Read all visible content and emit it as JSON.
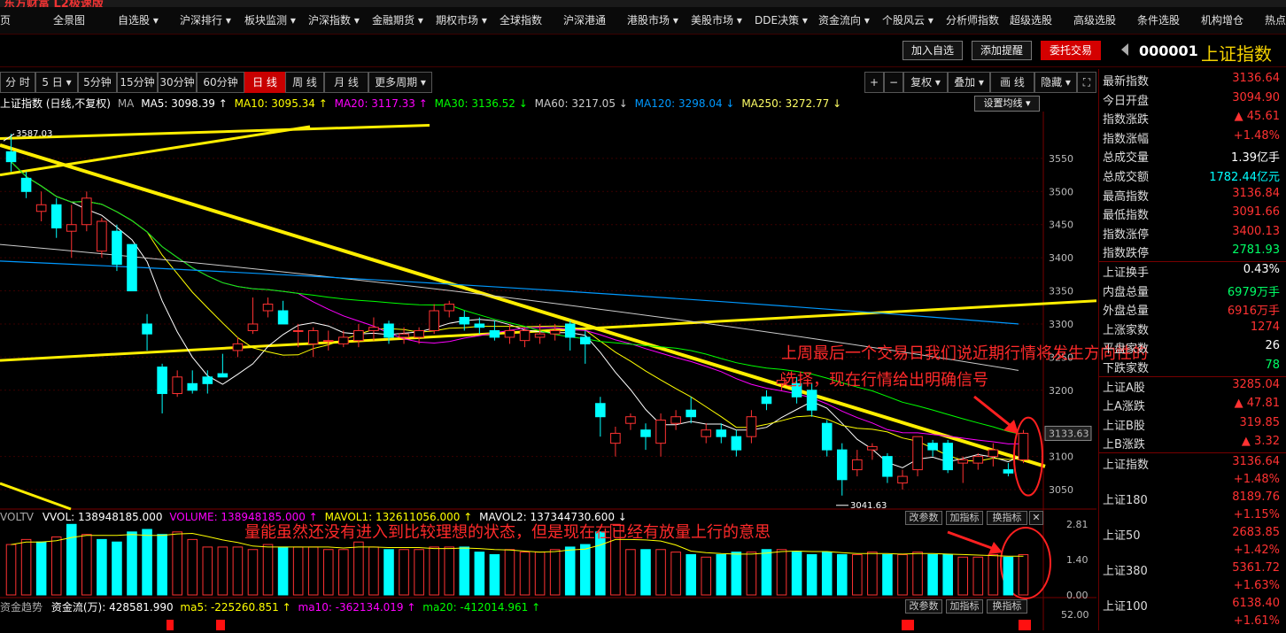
{
  "app": {
    "logo": "东方财富 L2极速版"
  },
  "menu": [
    "页",
    "全景图",
    "自选股 ▾",
    "沪深排行 ▾",
    "板块监测 ▾",
    "沪深指数 ▾",
    "金融期货 ▾",
    "期权市场 ▾",
    "全球指数",
    "沪深港通",
    "港股市场 ▾",
    "美股市场 ▾",
    "DDE决策 ▾",
    "资金流向 ▾",
    "个股风云 ▾",
    "分析师指数",
    "超级选股",
    "高级选股",
    "条件选股",
    "机构增仓",
    "热点"
  ],
  "toolbar": {
    "add_watch": "加入自选",
    "add_alert": "添加提醒",
    "trade": "委托交易"
  },
  "stock": {
    "code": "000001",
    "name": "上证指数"
  },
  "periods": [
    "分 时",
    "5 日 ▾",
    "5分钟",
    "15分钟",
    "30分钟",
    "60分钟",
    "日 线",
    "周 线",
    "月 线",
    "更多周期 ▾"
  ],
  "period_active": 6,
  "chart_tools": [
    "+",
    "−",
    "复权 ▾",
    "叠加 ▾",
    "画 线",
    "隐藏 ▾",
    "⛶"
  ],
  "ma_header": {
    "title": "上证指数 (日线,不复权)",
    "ma_tag": "MA",
    "ma5": "MA5: 3098.39 ↑",
    "ma10": "MA10: 3095.34 ↑",
    "ma20": "MA20: 3117.33 ↑",
    "ma30": "MA30: 3136.52 ↓",
    "ma60": "MA60: 3217.05 ↓",
    "ma120": "MA120: 3298.04 ↓",
    "ma250": "MA250: 3272.77 ↓",
    "setting": "设置均线 ▾"
  },
  "colors": {
    "up": "#ff3232",
    "down": "#00ffff",
    "ma5": "#ffffff",
    "ma10": "#ffff00",
    "ma20": "#ff00ff",
    "ma30": "#00ff00",
    "ma60": "#cccccc",
    "ma120": "#0099ff",
    "ma250": "#ffff66",
    "trend": "#ffee00",
    "accent": "#ff2a2a"
  },
  "chart_data": {
    "type": "candlestick",
    "price_axis": [
      3550.0,
      3500.0,
      3450.0,
      3400.0,
      3350.0,
      3300.0,
      3250.0,
      3200.0,
      3100.0,
      3050.0
    ],
    "last_price_label": "3133.63",
    "high_label": "3587.03",
    "low_label": "3041.63",
    "ylim": [
      3030,
      3610
    ],
    "candles": [
      [
        3560,
        3545,
        3587,
        3530
      ],
      [
        3520,
        3500,
        3530,
        3490
      ],
      [
        3470,
        3480,
        3500,
        3455
      ],
      [
        3480,
        3445,
        3490,
        3430
      ],
      [
        3440,
        3450,
        3480,
        3400
      ],
      [
        3450,
        3490,
        3500,
        3440
      ],
      [
        3410,
        3455,
        3460,
        3400
      ],
      [
        3440,
        3390,
        3450,
        3380
      ],
      [
        3420,
        3350,
        3420,
        3350
      ],
      [
        3300,
        3285,
        3315,
        3260
      ],
      [
        3235,
        3195,
        3240,
        3165
      ],
      [
        3195,
        3220,
        3230,
        3190
      ],
      [
        3210,
        3200,
        3230,
        3195
      ],
      [
        3220,
        3210,
        3230,
        3195
      ],
      [
        3225,
        3220,
        3255,
        3220
      ],
      [
        3260,
        3270,
        3280,
        3250
      ],
      [
        3290,
        3300,
        3340,
        3285
      ],
      [
        3320,
        3330,
        3340,
        3310
      ],
      [
        3320,
        3300,
        3335,
        3300
      ],
      [
        3290,
        3290,
        3300,
        3265
      ],
      [
        3270,
        3290,
        3295,
        3250
      ],
      [
        3275,
        3275,
        3290,
        3260
      ],
      [
        3270,
        3280,
        3290,
        3265
      ],
      [
        3275,
        3290,
        3300,
        3265
      ],
      [
        3290,
        3295,
        3310,
        3275
      ],
      [
        3300,
        3280,
        3305,
        3270
      ],
      [
        3280,
        3285,
        3295,
        3270
      ],
      [
        3280,
        3290,
        3295,
        3270
      ],
      [
        3290,
        3320,
        3330,
        3285
      ],
      [
        3320,
        3330,
        3335,
        3310
      ],
      [
        3310,
        3300,
        3320,
        3290
      ],
      [
        3300,
        3295,
        3310,
        3285
      ],
      [
        3290,
        3280,
        3305,
        3275
      ],
      [
        3280,
        3290,
        3300,
        3270
      ],
      [
        3275,
        3290,
        3295,
        3265
      ],
      [
        3280,
        3285,
        3300,
        3270
      ],
      [
        3285,
        3290,
        3300,
        3275
      ],
      [
        3300,
        3280,
        3305,
        3260
      ],
      [
        3280,
        3270,
        3290,
        3240
      ],
      [
        3180,
        3160,
        3190,
        3130
      ],
      [
        3120,
        3135,
        3145,
        3100
      ],
      [
        3150,
        3160,
        3165,
        3140
      ],
      [
        3140,
        3130,
        3150,
        3110
      ],
      [
        3120,
        3155,
        3165,
        3100
      ],
      [
        3150,
        3160,
        3170,
        3140
      ],
      [
        3170,
        3160,
        3190,
        3150
      ],
      [
        3130,
        3140,
        3150,
        3120
      ],
      [
        3140,
        3130,
        3150,
        3120
      ],
      [
        3130,
        3110,
        3140,
        3100
      ],
      [
        3130,
        3160,
        3170,
        3120
      ],
      [
        3190,
        3180,
        3200,
        3170
      ],
      [
        3210,
        3215,
        3225,
        3200
      ],
      [
        3210,
        3190,
        3220,
        3180
      ],
      [
        3200,
        3170,
        3210,
        3160
      ],
      [
        3150,
        3110,
        3155,
        3100
      ],
      [
        3110,
        3065,
        3120,
        3041
      ],
      [
        3080,
        3095,
        3110,
        3070
      ],
      [
        3110,
        3115,
        3120,
        3095
      ],
      [
        3100,
        3070,
        3105,
        3060
      ],
      [
        3060,
        3070,
        3080,
        3050
      ],
      [
        3080,
        3130,
        3130,
        3070
      ],
      [
        3120,
        3110,
        3125,
        3100
      ],
      [
        3120,
        3080,
        3125,
        3075
      ],
      [
        3090,
        3095,
        3100,
        3060
      ],
      [
        3090,
        3100,
        3105,
        3080
      ],
      [
        3100,
        3110,
        3120,
        3085
      ],
      [
        3080,
        3075,
        3090,
        3070
      ],
      [
        3095,
        3135,
        3140,
        3090
      ]
    ],
    "volume_axis": [
      "2.81",
      "1.40",
      "0.00"
    ],
    "volume_label_values": {
      "vvol": "VVOL: 138948185.000",
      "volume": "VOLUME: 138948185.000 ↑",
      "mavol1": "MAVOL1: 132611056.000 ↑",
      "mavol2": "MAVOL2: 137344730.600 ↓"
    },
    "volumes": [
      2.0,
      2.2,
      2.1,
      2.3,
      2.8,
      2.4,
      2.2,
      2.1,
      2.5,
      2.6,
      2.4,
      2.5,
      2.2,
      1.9,
      1.9,
      1.9,
      1.8,
      2.0,
      1.9,
      1.9,
      1.9,
      1.8,
      1.8,
      2.1,
      1.9,
      1.8,
      1.8,
      1.8,
      1.9,
      1.9,
      1.9,
      1.7,
      1.6,
      1.8,
      1.7,
      1.7,
      1.8,
      1.9,
      2.0,
      2.5,
      2.8,
      1.8,
      1.8,
      1.8,
      1.7,
      1.6,
      1.5,
      1.6,
      1.7,
      1.7,
      1.8,
      1.8,
      1.7,
      1.6,
      1.7,
      1.6,
      1.6,
      1.7,
      1.6,
      1.6,
      1.7,
      1.6,
      1.6,
      1.5,
      1.5,
      1.6,
      1.5,
      1.6
    ],
    "volume_up": [
      true,
      true,
      false,
      true,
      false,
      true,
      false,
      false,
      false,
      false,
      false,
      true,
      true,
      true,
      true,
      true,
      true,
      true,
      false,
      true,
      true,
      true,
      true,
      true,
      true,
      false,
      true,
      true,
      true,
      true,
      false,
      false,
      false,
      true,
      true,
      true,
      true,
      false,
      false,
      false,
      true,
      true,
      false,
      true,
      true,
      false,
      true,
      false,
      false,
      true,
      false,
      true,
      false,
      false,
      false,
      false,
      true,
      true,
      false,
      true,
      true,
      false,
      false,
      true,
      true,
      true,
      false,
      true
    ]
  },
  "volume_panel": {
    "title": "VOLTV",
    "buttons": [
      "改参数",
      "加指标",
      "换指标"
    ],
    "close": "✕"
  },
  "fund_panel": {
    "title": "资金趋势",
    "flow": "资金流(万): 428581.990",
    "ma5": "ma5: -225260.851 ↑",
    "ma10": "ma10: -362134.019 ↑",
    "ma20": "ma20: -412014.961 ↑",
    "buttons": [
      "改参数",
      "加指标",
      "换指标"
    ],
    "axis": "52.00"
  },
  "annotations": {
    "note1_line1": "上周最后一个交易日我们说近期行情将发生方向性的",
    "note1_line2": "选择，现在行情给出明确信号",
    "note2": "量能虽然还没有进入到比较理想的状态，但是现在在已经有放量上行的意思"
  },
  "right_panel": [
    {
      "label": "最新指数",
      "value": "3136.64",
      "color": "#ff3232"
    },
    {
      "label": "今日开盘",
      "value": "3094.90",
      "color": "#ff3232"
    },
    {
      "label": "指数涨跌",
      "value": "▲ 45.61",
      "color": "#ff3232"
    },
    {
      "label": "指数涨幅",
      "value": "+1.48%",
      "color": "#ff3232"
    },
    {
      "label": "总成交量",
      "value": "1.39亿手",
      "color": "#ffffff"
    },
    {
      "label": "总成交额",
      "value": "1782.44亿元",
      "color": "#00ffff"
    },
    {
      "label": "最高指数",
      "value": "3136.84",
      "color": "#ff3232"
    },
    {
      "label": "最低指数",
      "value": "3091.66",
      "color": "#ff3232"
    },
    {
      "label": "指数涨停",
      "value": "3400.13",
      "color": "#ff3232"
    },
    {
      "label": "指数跌停",
      "value": "2781.93",
      "color": "#00ff66"
    },
    {
      "label": "上证换手",
      "value": "0.43%",
      "color": "#ffffff"
    },
    {
      "label": "内盘总量",
      "value": "6979万手",
      "color": "#00ff66"
    },
    {
      "label": "外盘总量",
      "value": "6916万手",
      "color": "#ff3232"
    },
    {
      "label": "上涨家数",
      "value": "1274",
      "color": "#ff3232"
    },
    {
      "label": "平盘家数",
      "value": "26",
      "color": "#ffffff"
    },
    {
      "label": "下跌家数",
      "value": "78",
      "color": "#00ff66"
    },
    {
      "label": "上证A股",
      "value": "3285.04",
      "color": "#ff3232"
    },
    {
      "label": "上A涨跌",
      "value": "▲ 47.81",
      "color": "#ff3232"
    },
    {
      "label": "上证B股",
      "value": "319.85",
      "color": "#ff3232"
    },
    {
      "label": "上B涨跌",
      "value": "▲ 3.32",
      "color": "#ff3232"
    }
  ],
  "right_indices": [
    {
      "label": "上证指数",
      "value": "3136.64",
      "pct": "+1.48%"
    },
    {
      "label": "上证180",
      "value": "8189.76",
      "pct": "+1.15%"
    },
    {
      "label": "上证50",
      "value": "2683.85",
      "pct": "+1.42%"
    },
    {
      "label": "上证380",
      "value": "5361.72",
      "pct": "+1.63%"
    },
    {
      "label": "上证100",
      "value": "6138.40",
      "pct": "+1.61%"
    }
  ]
}
